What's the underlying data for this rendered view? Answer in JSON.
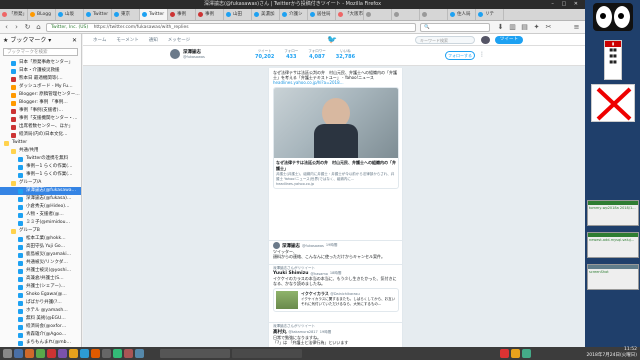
{
  "window_title": "深澤諭志(@fukasawas)さん | Twitterから投稿付きツイート - Mozilla Firefox",
  "tabs": [
    {
      "label": "「原発」",
      "color": "#e66"
    },
    {
      "label": "BLogg",
      "color": "#f90"
    },
    {
      "label": "山坂",
      "color": "#1da1f2"
    },
    {
      "label": "Twitter",
      "color": "#1da1f2"
    },
    {
      "label": "東京",
      "color": "#1da1f2"
    },
    {
      "label": "Twitter",
      "color": "#1da1f2"
    },
    {
      "label": "事例",
      "color": "#c33"
    },
    {
      "label": "事例",
      "color": "#c33"
    },
    {
      "label": "山田",
      "color": "#1da1f2"
    },
    {
      "label": "美濃加",
      "color": "#1da1f2"
    },
    {
      "label": "介護シ",
      "color": "#1da1f2"
    },
    {
      "label": "居住局",
      "color": "#1da1f2"
    },
    {
      "label": "「大阪市",
      "color": "#e66"
    },
    {
      "label": "",
      "color": "#999"
    },
    {
      "label": "",
      "color": "#999"
    },
    {
      "label": "",
      "color": "#999"
    },
    {
      "label": "住人局",
      "color": "#1da1f2"
    },
    {
      "label": "リテ",
      "color": "#1da1f2"
    }
  ],
  "url": "https://twitter.com/fukasawas/with_replies",
  "url_site": "Twitter, Inc. (US)",
  "search_placeholder": "ツイートを検索",
  "sidebar": {
    "title": "ブックマーク",
    "search_placeholder": "ブックマークを検索",
    "items": [
      {
        "label": "日本「原発事故センター」",
        "depth": 1,
        "color": "#1da1f2"
      },
      {
        "label": "日本・介護被災救援",
        "depth": 1,
        "color": "#1da1f2"
      },
      {
        "label": "熊本日 最適機関等(…",
        "depth": 1,
        "color": "#c33"
      },
      {
        "label": "ダッシュボード - My Fu…",
        "depth": 1,
        "color": "#f90"
      },
      {
        "label": "Blogger: 原稿管理センター…",
        "depth": 1,
        "color": "#f90"
      },
      {
        "label": "Blogger: 事例 「事例…",
        "depth": 1,
        "color": "#f90"
      },
      {
        "label": "事例「事例(支援者)…",
        "depth": 1,
        "color": "#c33"
      },
      {
        "label": "事例「支援機関センター・…",
        "depth": 1,
        "color": "#c33"
      },
      {
        "label": "出席者数センター、ほか」",
        "depth": 1,
        "color": "#c33"
      },
      {
        "label": "経済局(内の)日本文化…",
        "depth": 1,
        "color": "#c33"
      },
      {
        "label": "Twitter",
        "depth": 0,
        "color": "#ffd24d",
        "folder": true
      },
      {
        "label": "共通/共用",
        "depth": 1,
        "color": "#ffd24d",
        "folder": true
      },
      {
        "label": "Twitterの連携を無料",
        "depth": 2,
        "color": "#1da1f2"
      },
      {
        "label": "事例ー1 らくの作業(…",
        "depth": 2,
        "color": "#1da1f2"
      },
      {
        "label": "事例ー1 らくの作業(…",
        "depth": 2,
        "color": "#1da1f2"
      },
      {
        "label": "グループ/A",
        "depth": 1,
        "color": "#ffd24d",
        "folder": true
      },
      {
        "label": "深澤諭志(@fukasawa…",
        "depth": 2,
        "color": "#1da1f2",
        "selected": true
      },
      {
        "label": "深澤諭志(@fukasa)…",
        "depth": 2,
        "color": "#1da1f2"
      },
      {
        "label": "小倉秀夫(@Hideo)…",
        "depth": 2,
        "color": "#1da1f2"
      },
      {
        "label": "人物・支援者(@…",
        "depth": 2,
        "color": "#1da1f2"
      },
      {
        "label": "ミミ子(@mimidou…",
        "depth": 2,
        "color": "#1da1f2"
      },
      {
        "label": "グループB",
        "depth": 1,
        "color": "#ffd24d",
        "folder": true
      },
      {
        "label": "松本工業(@hokk…",
        "depth": 2,
        "color": "#1da1f2"
      },
      {
        "label": "高田守弘 Yuji Go…",
        "depth": 2,
        "color": "#1da1f2"
      },
      {
        "label": "鹿島被災(@yamaki…",
        "depth": 2,
        "color": "#1da1f2"
      },
      {
        "label": "共通被災/リンクダ…",
        "depth": 2,
        "color": "#1da1f2"
      },
      {
        "label": "弁護士被災(@yoshi…",
        "depth": 2,
        "color": "#1da1f2"
      },
      {
        "label": "高兼倉/弁護士(S…",
        "depth": 2,
        "color": "#1da1f2"
      },
      {
        "label": "弁護士(シェアー)…",
        "depth": 2,
        "color": "#1da1f2"
      },
      {
        "label": "Shoko Egawa(@…",
        "depth": 2,
        "color": "#1da1f2"
      },
      {
        "label": "ぱばかり弁護(?…",
        "depth": 2,
        "color": "#1da1f2"
      },
      {
        "label": "ホテル @yamash…",
        "depth": 2,
        "color": "#1da1f2"
      },
      {
        "label": "無料 美術(@EGU…",
        "depth": 2,
        "color": "#1da1f2"
      },
      {
        "label": "経済局会(@oxfor…",
        "depth": 2,
        "color": "#1da1f2"
      },
      {
        "label": "青森雄介(@Agoo…",
        "depth": 2,
        "color": "#1da1f2"
      },
      {
        "label": "まちもんまれ(@mb…",
        "depth": 2,
        "color": "#1da1f2"
      },
      {
        "label": "法令作成(@tokyo…",
        "depth": 2,
        "color": "#1da1f2"
      }
    ]
  },
  "twitter": {
    "nav": [
      "ホーム",
      "モーメント",
      "通知",
      "メッセージ"
    ],
    "search_placeholder": "キーワード検索",
    "tweet_button": "ツイート",
    "profile_name": "深澤諭志",
    "profile_handle": "@fukasawas",
    "stats": [
      {
        "label": "ツイート",
        "value": "70,202"
      },
      {
        "label": "フォロー",
        "value": "433"
      },
      {
        "label": "フォロワー",
        "value": "4,087"
      },
      {
        "label": "いいね",
        "value": "32,786"
      }
    ],
    "follow_button": "フォローする",
    "tweets": [
      {
        "name": "",
        "text": "なぜ法律テサは法廷公判の弁　村山元民、弁護士への組織内の「弁護士」を考える「弁護士テキストユー」 - Yahoo!ニュース",
        "link": "headlines.yahoo.co.jp/hl?a=2018…",
        "card_title": "なぜ法律テサは法廷公判の弁　村山元民、弁護士への組織内の「弁護士」",
        "card_text": "弁護士(弁護士)、組織内に弁護士・弁護士が今以前から法律部からされ、弁護士 Yahoo!ニュース(世界)ではなく、組織内に…",
        "card_domain": "headlines.yahoo.co.jp"
      },
      {
        "name": "深澤諭志",
        "handle": "@fukasawas",
        "time": "19時間",
        "text": "ツイッター、\n顔料からの連絡、こんなんに使っただけからキャンセル案件。"
      },
      {
        "retweet": "深澤諭志さんがリツイート",
        "name": "Yuuki Shimizu",
        "handle": "@hasamo",
        "time": "18時間",
        "text": "イクケイのカラスの本当の本当に、もう少し生きたかった、気付きになる、かなり読めましたね。",
        "quote_name": "イクケイカラス",
        "quote_handle": "@Dainichikarasu",
        "quote_text": "イクケイカラスに関するまたも。しばらくしてから、お互いそれに気付いていただけるなら、大気にするもの…"
      },
      {
        "retweet": "深澤諭志さんがリツイート",
        "name": "高村丸",
        "handle": "@takamura2817",
        "time": "19時間",
        "text": "日常で勉強になりますね。\n",
        "extra": "「?」は 「弁護士と法律行為」といいます"
      }
    ]
  },
  "right_panel": {
    "items": [
      {
        "label": "tommy-wp2018a 2018/1…",
        "color": "#2e7d32"
      },
      {
        "label": "newest-add-mysql-valuj…",
        "color": "#2e7d32"
      },
      {
        "label": "screenShot",
        "color": "#607d8b"
      }
    ]
  },
  "taskbar": {
    "clock_time": "11:52",
    "clock_date": "2018年7月24日(火曜日)"
  }
}
